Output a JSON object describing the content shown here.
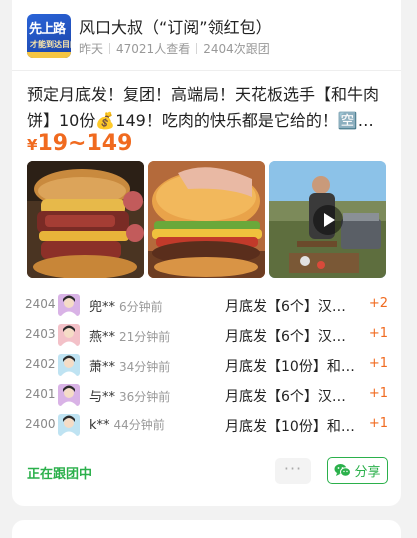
{
  "group": {
    "logo_text_1": "先上路",
    "logo_text_2": "才能到达目的地",
    "title": "风口大叔（“订阅”领红包）",
    "meta_time": "昨天",
    "meta_views": "47021人查看",
    "meta_joined": "2404次跟团"
  },
  "product": {
    "description": "预定月底发！复团！高端局！天花板选手【和牛肉饼】10份💰149！吃肉的快乐都是它给的！🈳最简...",
    "price_symbol": "¥",
    "price_range": "19~149",
    "images": [
      {
        "kind": "photo",
        "subject": "burger-cut-open"
      },
      {
        "kind": "photo",
        "subject": "burger-hand"
      },
      {
        "kind": "video",
        "subject": "outdoor-grill-chef"
      }
    ]
  },
  "orders": [
    {
      "no": "2404",
      "name": "兜**",
      "time": "6分钟前",
      "item": "月底发【6个】汉堡包...",
      "qty": "+2",
      "avatar_color": "#d9b3e6"
    },
    {
      "no": "2403",
      "name": "燕**",
      "time": "21分钟前",
      "item": "月底发【6个】汉堡包...",
      "qty": "+1",
      "avatar_color": "#f3c1c8"
    },
    {
      "no": "2402",
      "name": "萧**",
      "time": "34分钟前",
      "item": "月底发【10份】和牛肉饼...",
      "qty": "+1",
      "avatar_color": "#bfe3f2"
    },
    {
      "no": "2401",
      "name": "与**",
      "time": "36分钟前",
      "item": "月底发【6个】汉堡包...",
      "qty": "+1",
      "avatar_color": "#d9b3e6"
    },
    {
      "no": "2400",
      "name": "k**",
      "time": "44分钟前",
      "item": "月底发【10份】和牛肉饼...",
      "qty": "+1",
      "avatar_color": "#bfe3f2"
    }
  ],
  "footer": {
    "status": "正在跟团中",
    "more_label": "···",
    "share_label": "分享"
  },
  "colors": {
    "accent": "#f06a1f",
    "green": "#2bb04b"
  }
}
